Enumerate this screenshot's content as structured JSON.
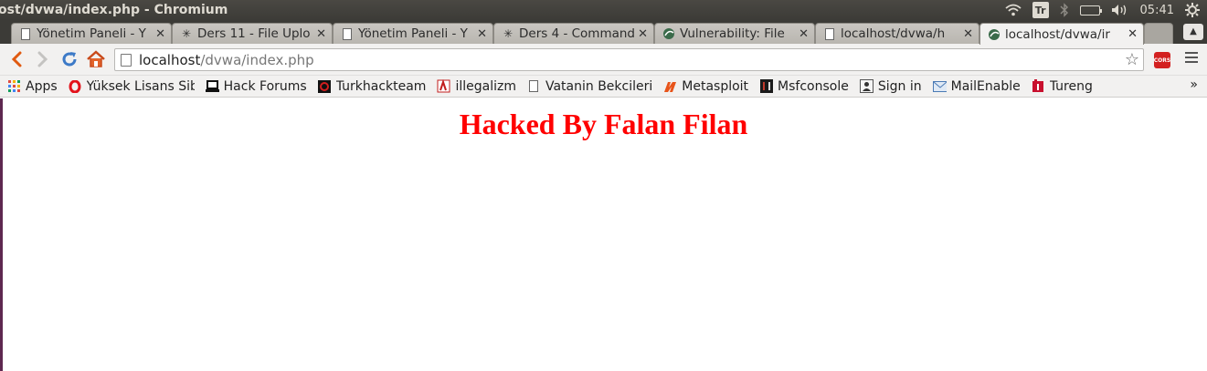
{
  "window": {
    "title": "ost/dvwa/index.php - Chromium"
  },
  "tray": {
    "keyboard": "Tr",
    "clock": "05:41"
  },
  "tabs": [
    {
      "label": "Yönetim Paneli - Y",
      "icon": "page-icon"
    },
    {
      "label": "Ders 11 - File Uplo",
      "icon": "spider-icon"
    },
    {
      "label": "Yönetim Paneli - Y",
      "icon": "page-icon"
    },
    {
      "label": "Ders 4 - Command",
      "icon": "spider-icon"
    },
    {
      "label": "Vulnerability: File",
      "icon": "dvwa-icon"
    },
    {
      "label": "localhost/dvwa/h",
      "icon": "page-icon"
    },
    {
      "label": "localhost/dvwa/ir",
      "icon": "dvwa-icon",
      "active": true
    }
  ],
  "toolbar": {
    "url_host": "localhost",
    "url_path": "/dvwa/index.php",
    "cors_label": "CORS"
  },
  "bookmarks": [
    {
      "label": "Apps",
      "icon": "apps-grid-icon"
    },
    {
      "label": "Yüksek Lisans Sib",
      "icon": "opera-icon"
    },
    {
      "label": "Hack Forums",
      "icon": "laptop-icon"
    },
    {
      "label": "Turkhackteam",
      "icon": "turkhackteam-icon"
    },
    {
      "label": "illegalizm",
      "icon": "illegalizm-icon"
    },
    {
      "label": "Vatanin Bekcileri",
      "icon": "page-icon"
    },
    {
      "label": "Metasploit",
      "icon": "metasploit-icon"
    },
    {
      "label": "Msfconsole",
      "icon": "msfconsole-icon"
    },
    {
      "label": "Sign in",
      "icon": "signin-icon"
    },
    {
      "label": "MailEnable",
      "icon": "mail-icon"
    },
    {
      "label": "Tureng",
      "icon": "tureng-icon"
    }
  ],
  "bookmarks_more": "»",
  "page": {
    "heading": "Hacked By Falan Filan"
  }
}
